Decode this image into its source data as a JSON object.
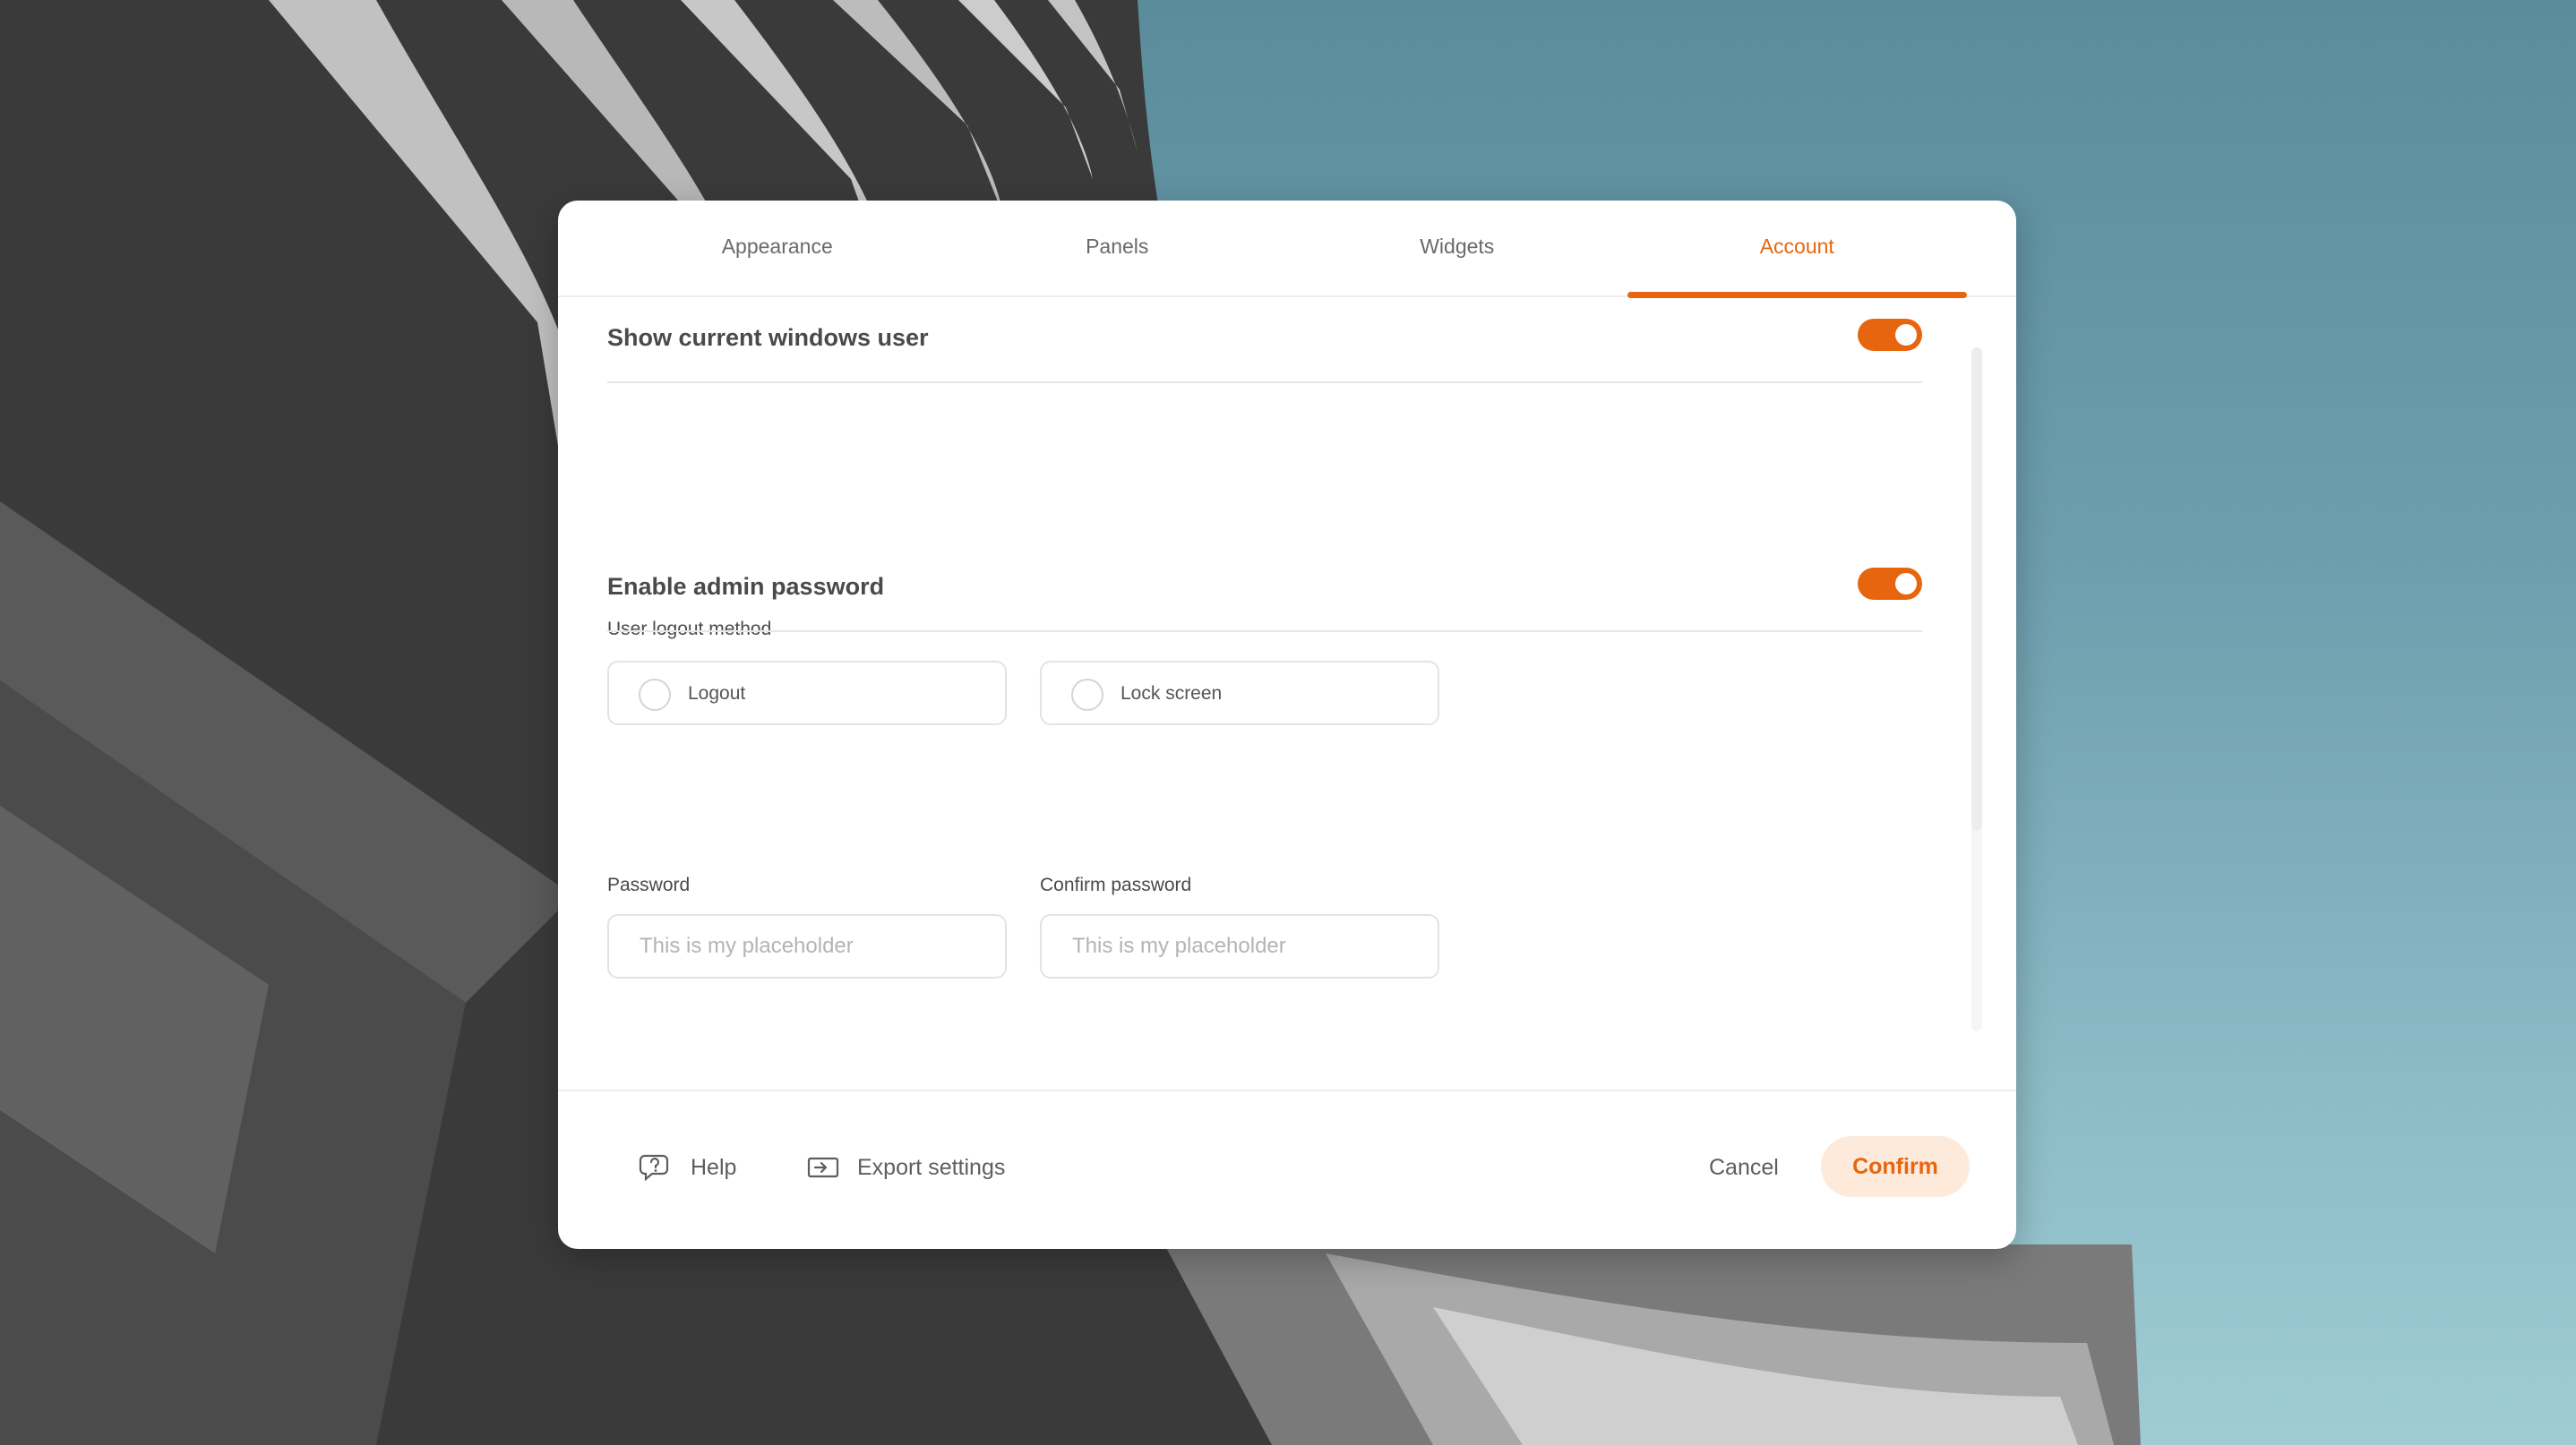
{
  "tabs": [
    {
      "label": "Appearance",
      "active": false
    },
    {
      "label": "Panels",
      "active": false
    },
    {
      "label": "Widgets",
      "active": false
    },
    {
      "label": "Account",
      "active": true
    }
  ],
  "show_user": {
    "title": "Show current windows user",
    "enabled": true,
    "logout_label": "User logout method",
    "options": [
      {
        "label": "Logout",
        "selected": false
      },
      {
        "label": "Lock screen",
        "selected": false
      }
    ]
  },
  "admin_password": {
    "title": "Enable admin password",
    "enabled": true,
    "password_label": "Password",
    "password_placeholder": "This is my placeholder",
    "confirm_label": "Confirm password",
    "confirm_placeholder": "This is my placeholder"
  },
  "footer": {
    "help_label": "Help",
    "export_label": "Export settings",
    "cancel_label": "Cancel",
    "confirm_label": "Confirm"
  },
  "colors": {
    "accent": "#e8650f",
    "accent_soft": "#fdeadb"
  },
  "icons": {
    "help": "chat-question-icon",
    "export": "export-icon"
  }
}
